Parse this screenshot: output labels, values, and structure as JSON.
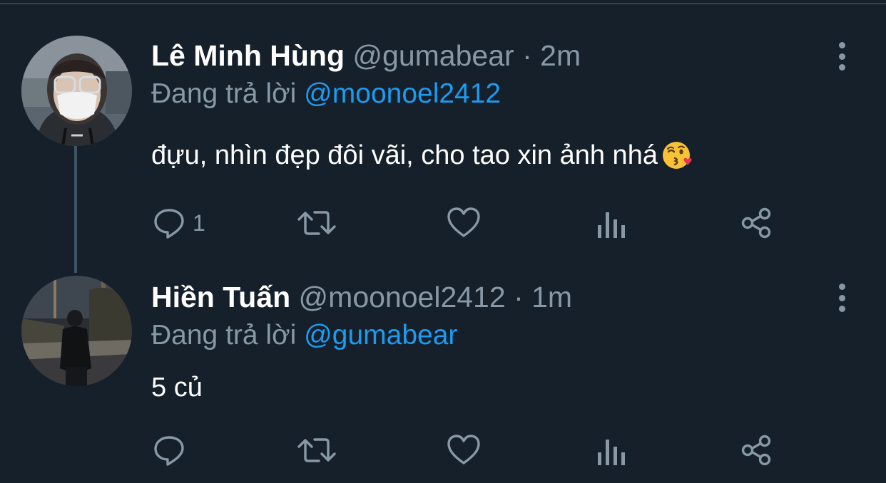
{
  "thread": [
    {
      "author": {
        "name": "Lê Minh Hùng",
        "handle": "@gumabear",
        "separator": "·",
        "time": "2m"
      },
      "reply_to": {
        "prefix": "Đang trả lời",
        "mention": "@moonoel2412"
      },
      "text": "đựu, nhìn đẹp đôi vãi, cho tao xin ảnh nhá",
      "emoji": "kissing-wink-heart-emoji",
      "actions": {
        "reply_count": "1",
        "retweet_count": "",
        "like_count": ""
      }
    },
    {
      "author": {
        "name": "Hiền Tuấn",
        "handle": "@moonoel2412",
        "separator": "·",
        "time": "1m"
      },
      "reply_to": {
        "prefix": "Đang trả lời",
        "mention": "@gumabear"
      },
      "text": "5 củ",
      "actions": {
        "reply_count": "",
        "retweet_count": "",
        "like_count": ""
      }
    }
  ],
  "icons": {
    "reply": "reply-icon",
    "retweet": "retweet-icon",
    "like": "like-icon",
    "analytics": "analytics-icon",
    "share": "share-icon",
    "more": "more-options-icon"
  },
  "colors": {
    "background": "#15202b",
    "primary_text": "#ffffff",
    "secondary_text": "#8899a6",
    "mention": "#1d9bf0",
    "thread_line": "#3d5466"
  }
}
